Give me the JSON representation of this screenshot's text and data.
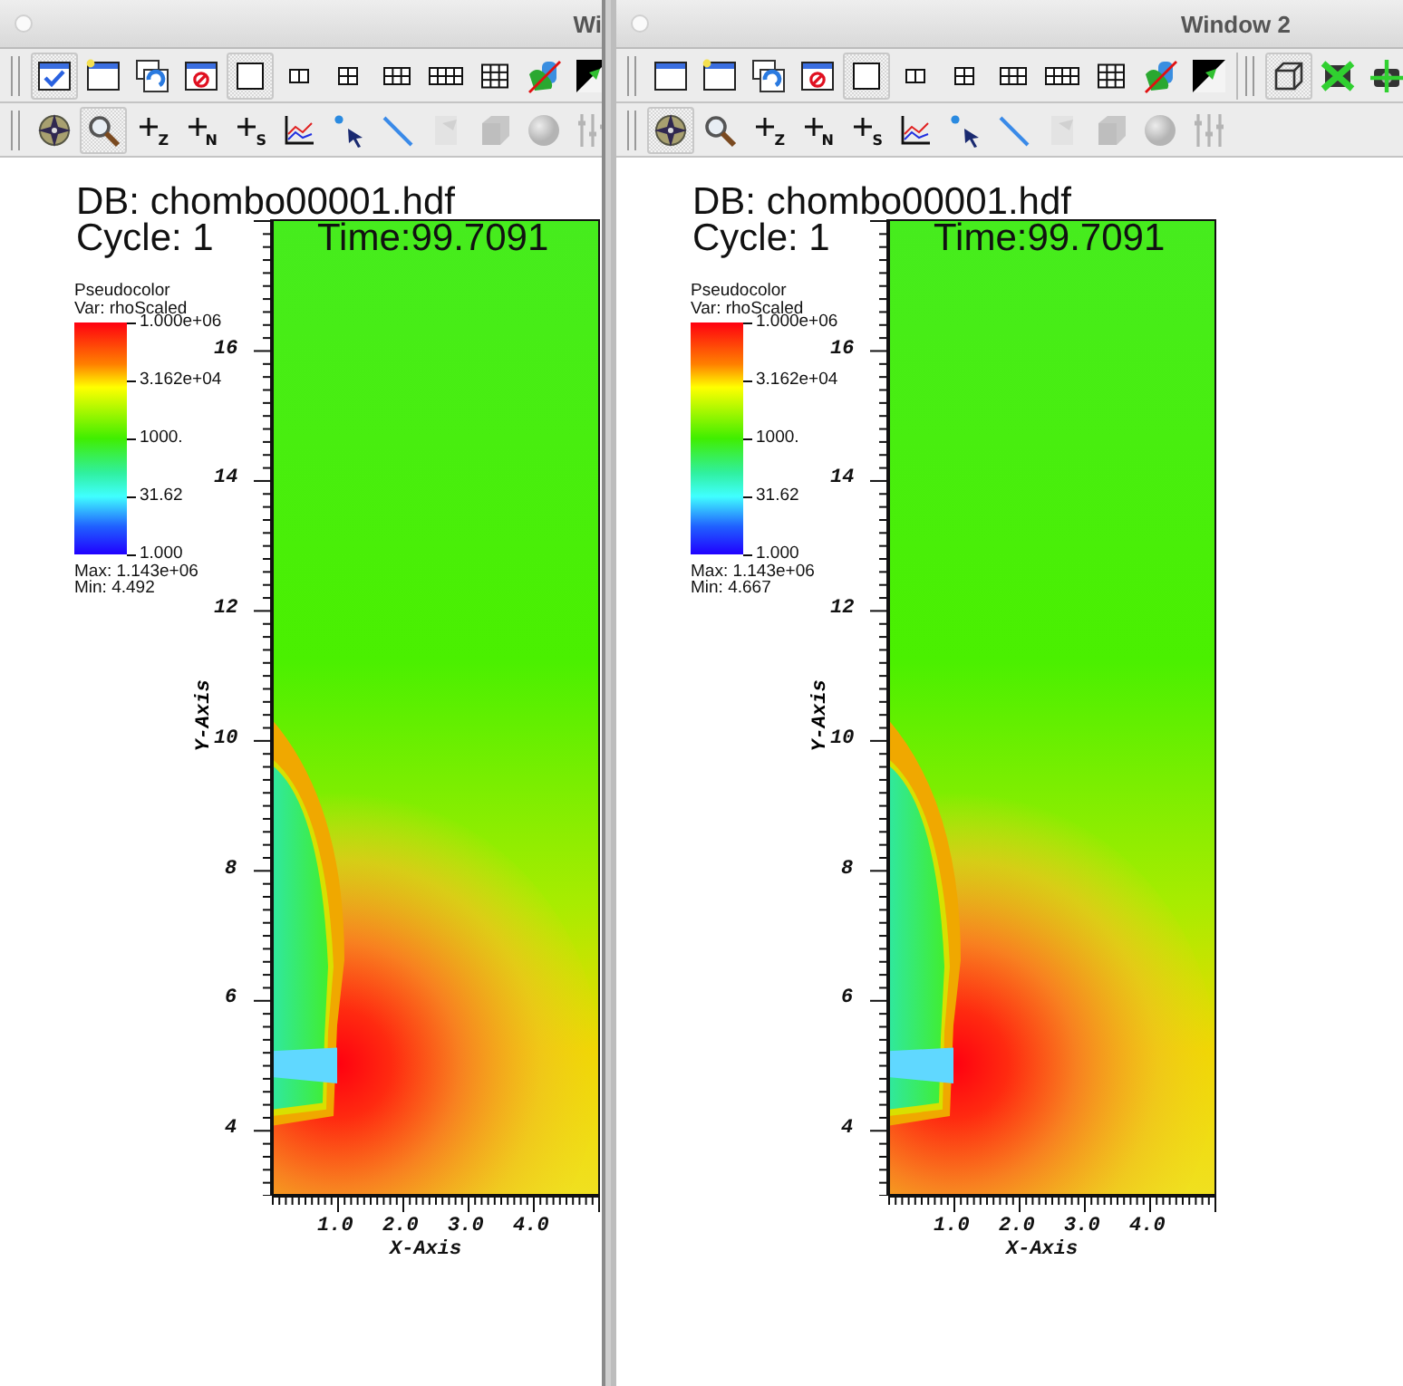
{
  "windows": [
    {
      "title": "Wi",
      "toolbars": [
        {
          "groups": [
            {
              "buttons": [
                {
                  "kind": "window-check",
                  "pressed": true
                },
                {
                  "kind": "window-new",
                  "pressed": false
                },
                {
                  "kind": "window-clone",
                  "pressed": false
                },
                {
                  "kind": "window-delete",
                  "pressed": false
                },
                {
                  "kind": "layout-1x1",
                  "pressed": true
                },
                {
                  "kind": "layout-1x2",
                  "pressed": false
                },
                {
                  "kind": "layout-2x2",
                  "pressed": false
                },
                {
                  "kind": "layout-2x3",
                  "pressed": false
                },
                {
                  "kind": "layout-2x4",
                  "pressed": false
                },
                {
                  "kind": "layout-3x3",
                  "pressed": false
                },
                {
                  "kind": "lock-view",
                  "pressed": false
                },
                {
                  "kind": "invert",
                  "pressed": false
                }
              ]
            }
          ]
        },
        {
          "groups": [
            {
              "buttons": [
                {
                  "kind": "navigate",
                  "pressed": false
                },
                {
                  "kind": "zoom",
                  "pressed": true
                },
                {
                  "kind": "plus",
                  "label": "Z",
                  "pressed": false
                },
                {
                  "kind": "plus",
                  "label": "N",
                  "pressed": false
                },
                {
                  "kind": "plus",
                  "label": "S",
                  "pressed": false
                },
                {
                  "kind": "curve",
                  "pressed": false
                },
                {
                  "kind": "pick",
                  "pressed": false
                },
                {
                  "kind": "line",
                  "pressed": false
                },
                {
                  "kind": "page",
                  "pressed": false,
                  "disabled": true
                },
                {
                  "kind": "cube",
                  "pressed": false,
                  "disabled": true
                },
                {
                  "kind": "sphere",
                  "pressed": false,
                  "disabled": true
                },
                {
                  "kind": "sliders",
                  "pressed": false,
                  "disabled": true
                }
              ]
            }
          ]
        }
      ],
      "plot": {
        "db": "DB: chombo00001.hdf",
        "cycle": "Cycle: 1",
        "time": "Time:99.7091",
        "legend": {
          "title": "Pseudocolor",
          "variable": "Var: rhoScaled",
          "labels": [
            "1.000e+06",
            "3.162e+04",
            "1000.",
            "31.62",
            "1.000"
          ],
          "max": "Max:  1.143e+06",
          "min": "Min:  4.492"
        },
        "y_axis": {
          "label": "Y-Axis",
          "ticks": [
            "16",
            "14",
            "12",
            "10",
            "8",
            "6",
            "4"
          ]
        },
        "x_axis": {
          "label": "X-Axis",
          "ticks": [
            "1.0",
            "2.0",
            "3.0",
            "4.0"
          ]
        }
      }
    },
    {
      "title": "Window 2",
      "toolbars": [
        {
          "groups": [
            {
              "buttons": [
                {
                  "kind": "window-plain",
                  "pressed": false
                },
                {
                  "kind": "window-new",
                  "pressed": false
                },
                {
                  "kind": "window-clone",
                  "pressed": false
                },
                {
                  "kind": "window-delete",
                  "pressed": false
                },
                {
                  "kind": "layout-1x1",
                  "pressed": true
                },
                {
                  "kind": "layout-1x2",
                  "pressed": false
                },
                {
                  "kind": "layout-2x2",
                  "pressed": false
                },
                {
                  "kind": "layout-2x3",
                  "pressed": false
                },
                {
                  "kind": "layout-2x4",
                  "pressed": false
                },
                {
                  "kind": "layout-3x3",
                  "pressed": false
                },
                {
                  "kind": "lock-view",
                  "pressed": false
                },
                {
                  "kind": "invert",
                  "pressed": false
                }
              ]
            },
            {
              "buttons": [
                {
                  "kind": "box-3d",
                  "pressed": true
                },
                {
                  "kind": "spin-x",
                  "pressed": false
                },
                {
                  "kind": "camera-spin",
                  "pressed": false
                }
              ]
            }
          ]
        },
        {
          "groups": [
            {
              "buttons": [
                {
                  "kind": "navigate",
                  "pressed": true
                },
                {
                  "kind": "zoom",
                  "pressed": false
                },
                {
                  "kind": "plus",
                  "label": "Z",
                  "pressed": false
                },
                {
                  "kind": "plus",
                  "label": "N",
                  "pressed": false
                },
                {
                  "kind": "plus",
                  "label": "S",
                  "pressed": false
                },
                {
                  "kind": "curve",
                  "pressed": false
                },
                {
                  "kind": "pick",
                  "pressed": false
                },
                {
                  "kind": "line",
                  "pressed": false
                },
                {
                  "kind": "page",
                  "pressed": false,
                  "disabled": true
                },
                {
                  "kind": "cube",
                  "pressed": false,
                  "disabled": true
                },
                {
                  "kind": "sphere",
                  "pressed": false,
                  "disabled": true
                },
                {
                  "kind": "sliders",
                  "pressed": false,
                  "disabled": true
                }
              ]
            }
          ]
        }
      ],
      "plot": {
        "db": "DB: chombo00001.hdf",
        "cycle": "Cycle: 1",
        "time": "Time:99.7091",
        "legend": {
          "title": "Pseudocolor",
          "variable": "Var: rhoScaled",
          "labels": [
            "1.000e+06",
            "3.162e+04",
            "1000.",
            "31.62",
            "1.000"
          ],
          "max": "Max:  1.143e+06",
          "min": "Min:  4.667"
        },
        "y_axis": {
          "label": "Y-Axis",
          "ticks": [
            "16",
            "14",
            "12",
            "10",
            "8",
            "6",
            "4"
          ]
        },
        "x_axis": {
          "label": "X-Axis",
          "ticks": [
            "1.0",
            "2.0",
            "3.0",
            "4.0"
          ]
        }
      }
    }
  ]
}
